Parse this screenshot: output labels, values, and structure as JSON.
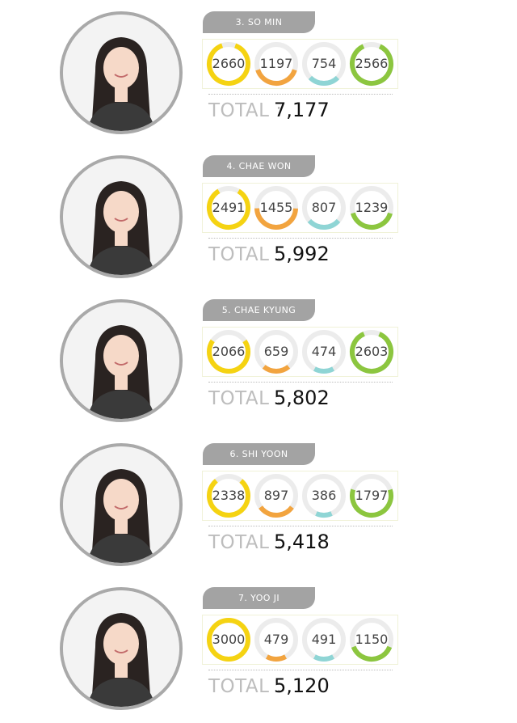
{
  "colors": {
    "ring_yellow": "#f5d312",
    "ring_orange": "#f2a43f",
    "ring_teal": "#8fd5d5",
    "ring_green": "#8cc63f",
    "ring_track": "#ececec",
    "tag_gray": "#a3a3a3",
    "photo_border": "#a9a9a9"
  },
  "entries": [
    {
      "name": "3. SO MIN",
      "scores": [
        "2660",
        "1197",
        "754",
        "2566"
      ],
      "levels": [
        0.89,
        0.4,
        0.25,
        0.86
      ],
      "total_label": "TOTAL :",
      "total": "7,177"
    },
    {
      "name": "4. CHAE WON",
      "scores": [
        "2491",
        "1455",
        "807",
        "1239"
      ],
      "levels": [
        0.83,
        0.49,
        0.27,
        0.41
      ],
      "total_label": "TOTAL :",
      "total": "5,992"
    },
    {
      "name": "5. CHAE KYUNG",
      "scores": [
        "2066",
        "659",
        "474",
        "2603"
      ],
      "levels": [
        0.69,
        0.22,
        0.16,
        0.87
      ],
      "total_label": "TOTAL :",
      "total": "5,802"
    },
    {
      "name": "6. SHI YOON",
      "scores": [
        "2338",
        "897",
        "386",
        "1797"
      ],
      "levels": [
        0.78,
        0.3,
        0.13,
        0.6
      ],
      "total_label": "TOTAL :",
      "total": "5,418"
    },
    {
      "name": "7. YOO JI",
      "scores": [
        "3000",
        "479",
        "491",
        "1150"
      ],
      "levels": [
        1.0,
        0.16,
        0.16,
        0.38
      ],
      "total_label": "TOTAL :",
      "total": "5,120"
    }
  ]
}
